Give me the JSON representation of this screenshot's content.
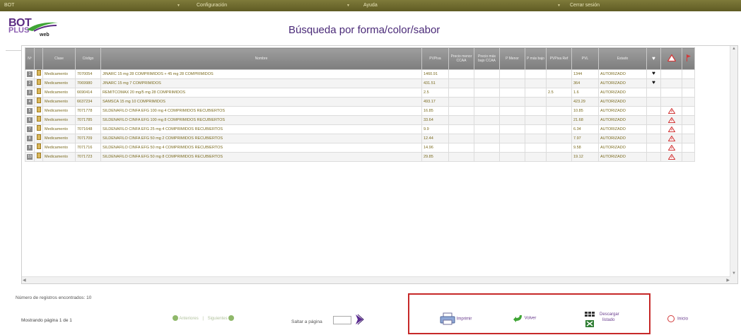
{
  "menu": {
    "app": "BOT",
    "items": [
      "Configuración",
      "Ayuda",
      "Cerrar sesión"
    ]
  },
  "logo": {
    "top": "BOT",
    "bottom": "PLUS",
    "suffix": "web"
  },
  "page_title": "Búsqueda por forma/color/sabor",
  "columns": [
    "Nº",
    "",
    "Clase",
    "Código",
    "Nombre",
    "PVPiva",
    "Precio menor CCAA",
    "Precio más bajo CCAA",
    "P Menor",
    "P más bajo",
    "PVPiva Ref",
    "PVL",
    "Estado"
  ],
  "rows": [
    {
      "n": "1",
      "clase": "Medicamento",
      "codigo": "7070054",
      "nombre": "JINARC 15 mg 28 COMPRIMIDOS + 45 mg 28 COMPRIMIDOS",
      "pvpiva": "1460.91",
      "ref": "",
      "pvl": "1344",
      "estado": "AUTORIZADO",
      "heart": true,
      "warn": false
    },
    {
      "n": "2",
      "clase": "Medicamento",
      "codigo": "7069980",
      "nombre": "JINARC 15 mg 7 COMPRIMIDOS",
      "pvpiva": "431.51",
      "ref": "",
      "pvl": "364",
      "estado": "AUTORIZADO",
      "heart": true,
      "warn": false
    },
    {
      "n": "3",
      "clase": "Medicamento",
      "codigo": "6690414",
      "nombre": "REMITCOMAX 20 mg/5 mg 28 COMPRIMIDOS",
      "pvpiva": "2.5",
      "ref": "2.5",
      "pvl": "1.6",
      "estado": "AUTORIZADO",
      "heart": false,
      "warn": false
    },
    {
      "n": "4",
      "clase": "Medicamento",
      "codigo": "6637234",
      "nombre": "SAMSCA 15 mg 10 COMPRIMIDOS",
      "pvpiva": "493.17",
      "ref": "",
      "pvl": "423.29",
      "estado": "AUTORIZADO",
      "heart": false,
      "warn": false
    },
    {
      "n": "5",
      "clase": "Medicamento",
      "codigo": "7071778",
      "nombre": "SILDENAFILO CINFA EFG 100 mg 4 COMPRIMIDOS RECUBIERTOS",
      "pvpiva": "16.85",
      "ref": "",
      "pvl": "10.85",
      "estado": "AUTORIZADO",
      "heart": false,
      "warn": true
    },
    {
      "n": "6",
      "clase": "Medicamento",
      "codigo": "7071785",
      "nombre": "SILDENAFILO CINFA EFG 100 mg 8 COMPRIMIDOS RECUBIERTOS",
      "pvpiva": "33.64",
      "ref": "",
      "pvl": "21.68",
      "estado": "AUTORIZADO",
      "heart": false,
      "warn": true
    },
    {
      "n": "7",
      "clase": "Medicamento",
      "codigo": "7071648",
      "nombre": "SILDENAFILO CINFA EFG 25 mg 4 COMPRIMIDOS RECUBIERTOS",
      "pvpiva": "9.9",
      "ref": "",
      "pvl": "6.34",
      "estado": "AUTORIZADO",
      "heart": false,
      "warn": true
    },
    {
      "n": "8",
      "clase": "Medicamento",
      "codigo": "7071709",
      "nombre": "SILDENAFILO CINFA EFG 50 mg 2 COMPRIMIDOS RECUBIERTOS",
      "pvpiva": "12.44",
      "ref": "",
      "pvl": "7.97",
      "estado": "AUTORIZADO",
      "heart": false,
      "warn": true
    },
    {
      "n": "9",
      "clase": "Medicamento",
      "codigo": "7071716",
      "nombre": "SILDENAFILO CINFA EFG 50 mg 4 COMPRIMIDOS RECUBIERTOS",
      "pvpiva": "14.96",
      "ref": "",
      "pvl": "9.58",
      "estado": "AUTORIZADO",
      "heart": false,
      "warn": true
    },
    {
      "n": "10",
      "clase": "Medicamento",
      "codigo": "7071723",
      "nombre": "SILDENAFILO CINFA EFG 50 mg 8 COMPRIMIDOS RECUBIERTOS",
      "pvpiva": "29.85",
      "ref": "",
      "pvl": "19.12",
      "estado": "AUTORIZADO",
      "heart": false,
      "warn": true
    }
  ],
  "footer": {
    "count_text": "Número de registros encontrados: 10",
    "page_text": "Mostrando página 1 de 1",
    "prev": "Anteriores",
    "next": "Siguientes",
    "goto_label": "Saltar a página",
    "goto_value": "",
    "print": "Imprimir",
    "back": "Volver",
    "download_line1": "Descargar",
    "download_line2": "listado",
    "home": "Inicio"
  },
  "colors": {
    "accent": "#4a2a78",
    "menu_bar": "#6b6730",
    "highlight_border": "#c62828"
  }
}
